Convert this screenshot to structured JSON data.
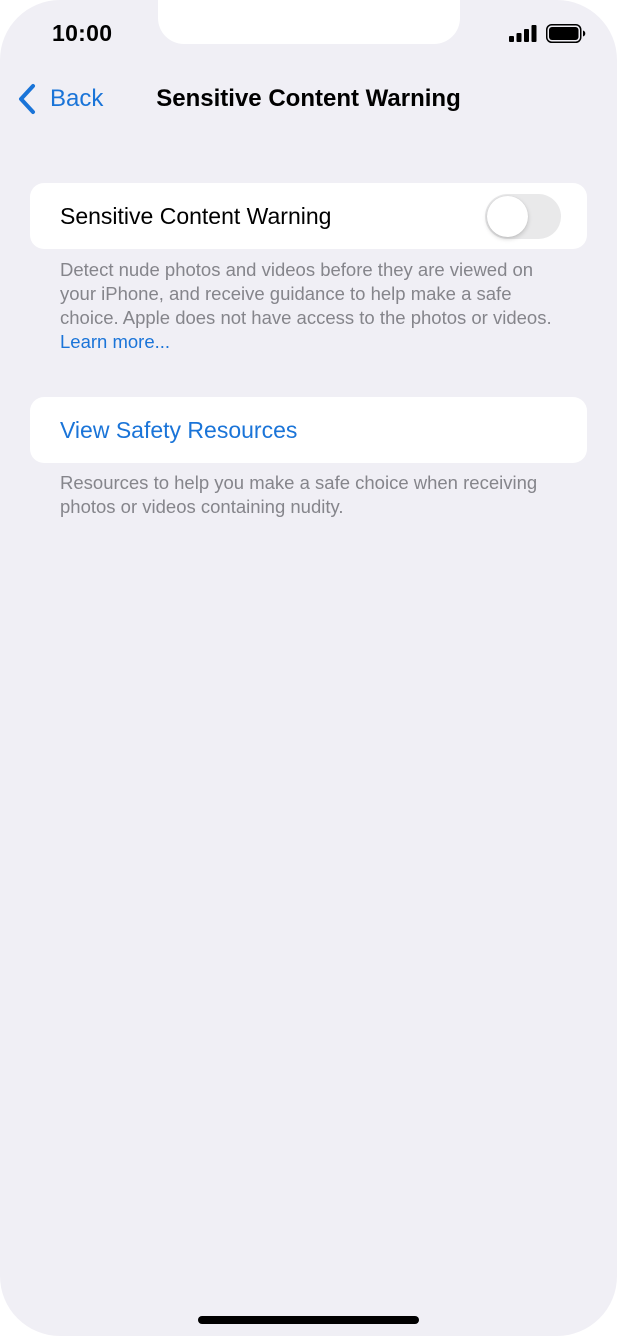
{
  "status_bar": {
    "time": "10:00",
    "signal_icon": "cellular-signal-icon",
    "battery_icon": "battery-full-icon"
  },
  "nav": {
    "back_label": "Back",
    "back_icon": "chevron-left-icon",
    "title": "Sensitive Content Warning"
  },
  "sensitive_warning": {
    "label": "Sensitive Content Warning",
    "enabled": false,
    "footnote": "Detect nude photos and videos before they are viewed on your iPhone, and receive guidance to help make a safe choice. Apple does not have access to the photos or videos.",
    "learn_more": "Learn more..."
  },
  "safety_resources": {
    "label": "View Safety Resources",
    "footnote": "Resources to help you make a safe choice when receiving photos or videos containing nudity."
  },
  "colors": {
    "background": "#f0eff5",
    "card": "#ffffff",
    "accent": "#1a74d8",
    "secondary_text": "#85858b",
    "toggle_off": "#e9e9ea"
  }
}
